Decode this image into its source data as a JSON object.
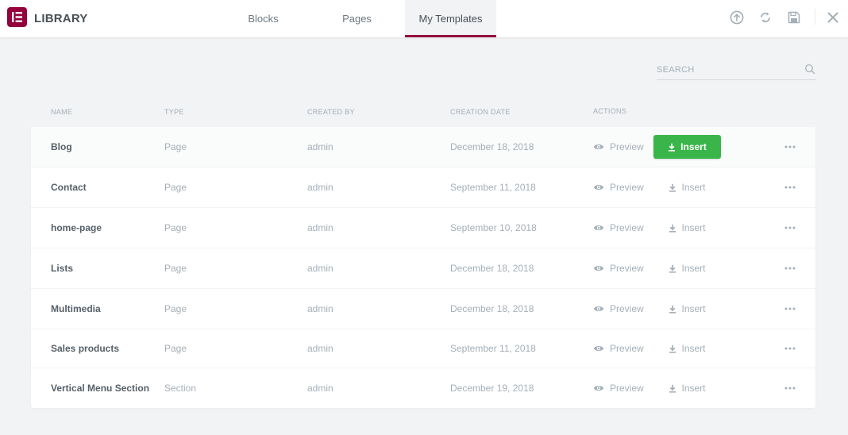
{
  "header": {
    "title": "LIBRARY",
    "tabs": [
      {
        "label": "Blocks"
      },
      {
        "label": "Pages"
      },
      {
        "label": "My Templates"
      }
    ],
    "active_tab": "My Templates",
    "icons": [
      "upload-icon",
      "sync-icon",
      "save-icon",
      "close-icon"
    ]
  },
  "search": {
    "placeholder": "SEARCH",
    "value": ""
  },
  "columns": {
    "name": "NAME",
    "type": "TYPE",
    "created_by": "CREATED BY",
    "creation_date": "CREATION DATE",
    "actions": "ACTIONS"
  },
  "actions": {
    "preview_label": "Preview",
    "insert_label": "Insert"
  },
  "rows": [
    {
      "name": "Blog",
      "type": "Page",
      "created_by": "admin",
      "date": "December 18, 2018"
    },
    {
      "name": "Contact",
      "type": "Page",
      "created_by": "admin",
      "date": "September 11, 2018"
    },
    {
      "name": "home-page",
      "type": "Page",
      "created_by": "admin",
      "date": "September 10, 2018"
    },
    {
      "name": "Lists",
      "type": "Page",
      "created_by": "admin",
      "date": "December 18, 2018"
    },
    {
      "name": "Multimedia",
      "type": "Page",
      "created_by": "admin",
      "date": "December 18, 2018"
    },
    {
      "name": "Sales products",
      "type": "Page",
      "created_by": "admin",
      "date": "September 11, 2018"
    },
    {
      "name": "Vertical Menu Section",
      "type": "Section",
      "created_by": "admin",
      "date": "December 19, 2018"
    }
  ],
  "highlighted_row": 0,
  "colors": {
    "brand": "#93003c",
    "insert_green": "#39b54a",
    "background": "#f1f3f5"
  }
}
